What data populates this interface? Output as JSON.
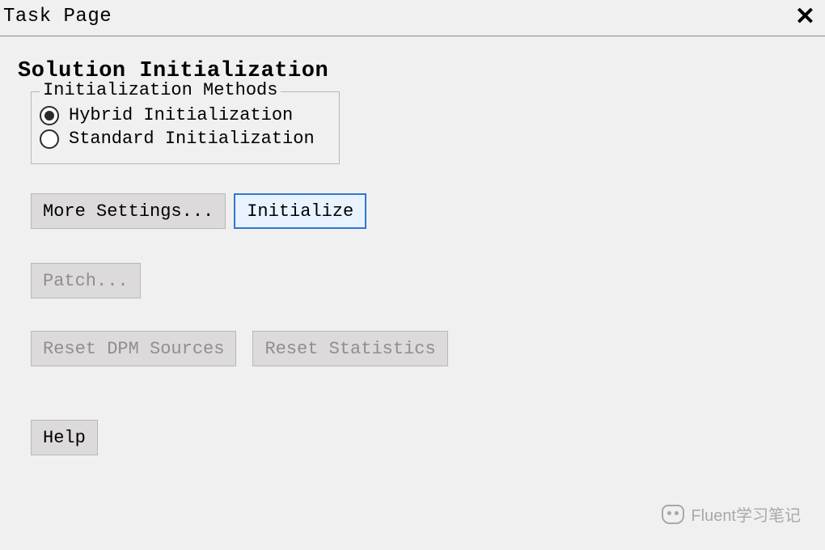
{
  "titlebar": {
    "title": "Task Page",
    "close_glyph": "✕"
  },
  "page": {
    "heading": "Solution Initialization"
  },
  "init_methods": {
    "legend": "Initialization Methods",
    "options": [
      {
        "id": "hybrid",
        "label": "Hybrid  Initialization",
        "selected": true
      },
      {
        "id": "standard",
        "label": "Standard Initialization",
        "selected": false
      }
    ]
  },
  "buttons": {
    "more_settings": "More Settings...",
    "initialize": "Initialize",
    "patch": "Patch...",
    "reset_dpm": "Reset DPM Sources",
    "reset_stats": "Reset Statistics",
    "help": "Help"
  },
  "button_state": {
    "more_settings": "enabled",
    "initialize": "highlight",
    "patch": "disabled",
    "reset_dpm": "disabled",
    "reset_stats": "disabled",
    "help": "enabled"
  },
  "watermark": {
    "text": "Fluent学习笔记"
  }
}
